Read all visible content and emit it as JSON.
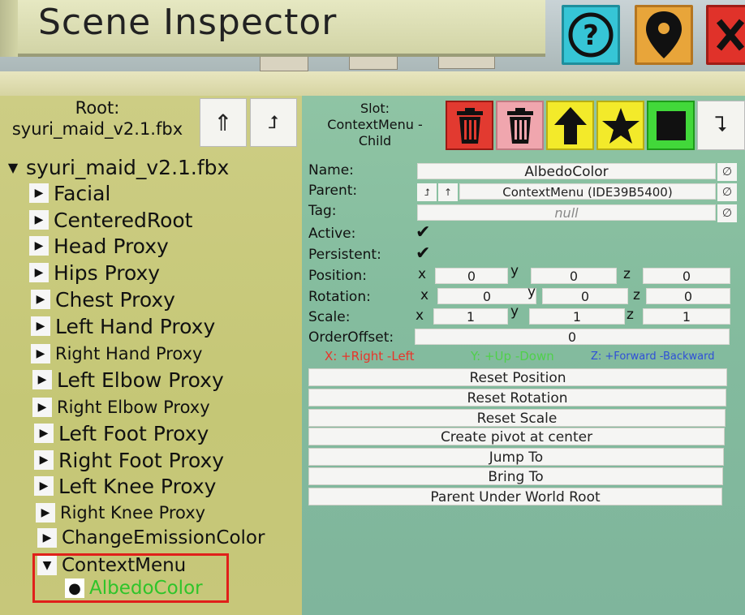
{
  "window": {
    "title": "Scene Inspector",
    "buttons": {
      "help": "?",
      "location": "location-pin-icon",
      "close": "close-icon"
    }
  },
  "hierarchy": {
    "root_label": "Root:",
    "root_name": "syuri_maid_v2.1.fbx",
    "nav_up_all": "⇑",
    "nav_up": "⮥",
    "items": [
      {
        "label": "syuri_maid_v2.1.fbx",
        "toggle": "▼",
        "level": 0
      },
      {
        "label": "Facial",
        "toggle": "▶",
        "level": 1
      },
      {
        "label": "CenteredRoot",
        "toggle": "▶",
        "level": 1
      },
      {
        "label": "Head Proxy",
        "toggle": "▶",
        "level": 1
      },
      {
        "label": "Hips Proxy",
        "toggle": "▶",
        "level": 1
      },
      {
        "label": "Chest Proxy",
        "toggle": "▶",
        "level": 1
      },
      {
        "label": "Left Hand Proxy",
        "toggle": "▶",
        "level": 1
      },
      {
        "label": "Right Hand Proxy",
        "toggle": "▶",
        "level": 1
      },
      {
        "label": "Left Elbow Proxy",
        "toggle": "▶",
        "level": 1
      },
      {
        "label": "Right Elbow Proxy",
        "toggle": "▶",
        "level": 1
      },
      {
        "label": "Left Foot Proxy",
        "toggle": "▶",
        "level": 1
      },
      {
        "label": "Right Foot Proxy",
        "toggle": "▶",
        "level": 1
      },
      {
        "label": "Left Knee Proxy",
        "toggle": "▶",
        "level": 1
      },
      {
        "label": "Right Knee Proxy",
        "toggle": "▶",
        "level": 1
      },
      {
        "label": "ChangeEmissionColor",
        "toggle": "▶",
        "level": 1
      },
      {
        "label": "ContextMenu",
        "toggle": "▼",
        "level": 1
      },
      {
        "label": "AlbedoColor",
        "toggle": "●",
        "level": 2,
        "selected": true
      }
    ]
  },
  "inspector": {
    "slot_label": "Slot:\nContextMenu -\nChild",
    "slot_lines": [
      "Slot:",
      "ContextMenu -",
      "Child"
    ],
    "action_buttons": [
      "trash-icon",
      "trash-icon",
      "up-arrow-icon",
      "star-icon",
      "square-icon",
      "return-arrow-icon"
    ],
    "action_return": "⮧",
    "name_label": "Name:",
    "name_value": "AlbedoColor",
    "parent_label": "Parent:",
    "parent_value": "ContextMenu (IDE39B5400)",
    "parent_nav": [
      "⮥",
      "↑"
    ],
    "tag_label": "Tag:",
    "tag_value": "null",
    "null_symbol": "∅",
    "active_label": "Active:",
    "persistent_label": "Persistent:",
    "checkmark": "✔",
    "position_label": "Position:",
    "rotation_label": "Rotation:",
    "scale_label": "Scale:",
    "order_offset_label": "OrderOffset:",
    "axes": {
      "x": "x",
      "y": "y",
      "z": "z"
    },
    "position": {
      "x": "0",
      "y": "0",
      "z": "0"
    },
    "rotation": {
      "x": "0",
      "y": "0",
      "z": "0"
    },
    "scale": {
      "x": "1",
      "y": "1",
      "z": "1"
    },
    "order_offset": "0",
    "hints": {
      "x": "X: +Right -Left",
      "y": "Y: +Up -Down",
      "z": "Z: +Forward -Backward"
    },
    "actions": [
      "Reset Position",
      "Reset Rotation",
      "Reset Scale",
      "Create pivot at center",
      "Jump To",
      "Bring To",
      "Parent Under World Root"
    ]
  },
  "colors": {
    "hint_x": "#e8342a",
    "hint_y": "#4fd04a",
    "hint_z": "#2f4fd8",
    "selected_text": "#2fc42a",
    "selected_border": "#e0201a"
  }
}
